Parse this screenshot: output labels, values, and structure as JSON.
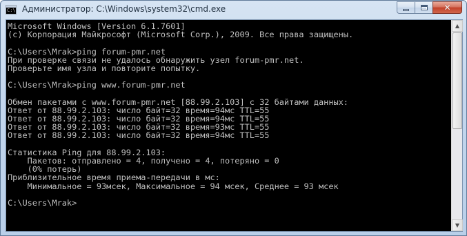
{
  "window": {
    "title": "Администратор: C:\\Windows\\system32\\cmd.exe",
    "icon_text": "C:\\",
    "controls": {
      "minimize": "minimize-icon",
      "maximize": "maximize-icon",
      "close": "close-icon"
    }
  },
  "console": {
    "lines": [
      "Microsoft Windows [Version 6.1.7601]",
      "(c) Корпорация Майкрософт (Microsoft Corp.), 2009. Все права защищены.",
      "",
      "C:\\Users\\Mrak>ping forum-pmr.net",
      "При проверке связи не удалось обнаружить узел forum-pmr.net.",
      "Проверьте имя узла и повторите попытку.",
      "",
      "C:\\Users\\Mrak>ping www.forum-pmr.net",
      "",
      "Обмен пакетами с www.forum-pmr.net [88.99.2.103] с 32 байтами данных:",
      "Ответ от 88.99.2.103: число байт=32 время=94мс TTL=55",
      "Ответ от 88.99.2.103: число байт=32 время=94мс TTL=55",
      "Ответ от 88.99.2.103: число байт=32 время=93мс TTL=55",
      "Ответ от 88.99.2.103: число байт=32 время=94мс TTL=55",
      "",
      "Статистика Ping для 88.99.2.103:",
      "    Пакетов: отправлено = 4, получено = 4, потеряно = 0",
      "    (0% потерь)",
      "Приблизительное время приема-передачи в мс:",
      "    Минимальное = 93мсек, Максимальное = 94 мсек, Среднее = 93 мсек",
      "",
      "C:\\Users\\Mrak>"
    ]
  },
  "colors": {
    "console_bg": "#000000",
    "console_fg": "#c0c0c0",
    "close_button": "#c2412a"
  }
}
